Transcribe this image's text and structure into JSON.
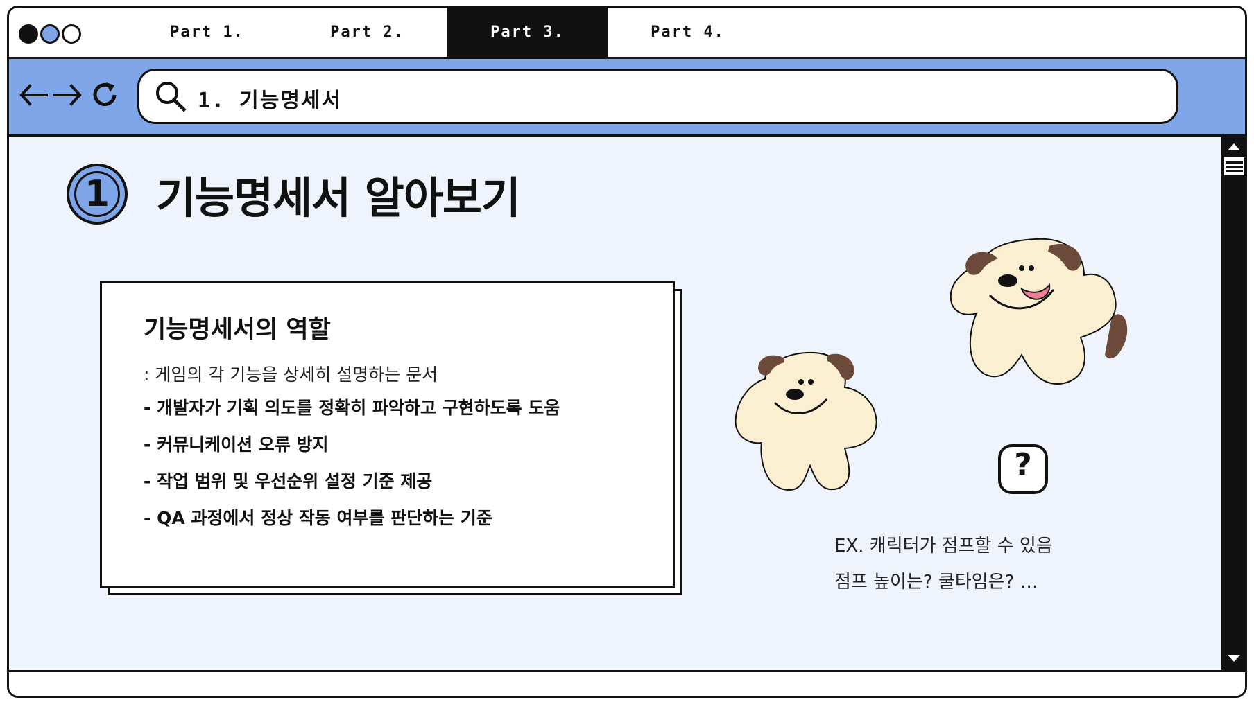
{
  "window": {
    "dots": [
      "black",
      "blue",
      "white"
    ],
    "tabs": [
      {
        "label": "Part 1.",
        "active": false
      },
      {
        "label": "Part 2.",
        "active": false
      },
      {
        "label": "Part 3.",
        "active": true
      },
      {
        "label": "Part 4.",
        "active": false
      }
    ]
  },
  "nav": {
    "back_icon": "arrow-left-icon",
    "forward_icon": "arrow-right-icon",
    "reload_icon": "reload-icon",
    "search_icon": "search-icon",
    "address": "1. 기능명세서"
  },
  "content": {
    "section_number": "1",
    "heading": "기능명세서 알아보기",
    "card": {
      "title": "기능명세서의 역할",
      "subtitle": ": 게임의 각 기능을 상세히 설명하는 문서",
      "items": [
        "- 개발자가 기획 의도를 정확히 파악하고 구현하도록 도움",
        "- 커뮤니케이션 오류 방지",
        "- 작업 범위 및 우선순위 설정 기준 제공",
        "- QA 과정에서 정상 작동 여부를 판단하는 기준"
      ]
    },
    "example": {
      "line1": "EX. 캐릭터가 점프할 수 있음",
      "line2": "점프 높이는? 쿨타임은? …"
    },
    "question_mark": "?"
  },
  "colors": {
    "accent_blue": "#7ea6e8",
    "content_bg": "#eef3fc",
    "dog_cream": "#faefd0",
    "dog_brown": "#6b4a3a",
    "tongue_pink": "#f27e96"
  }
}
